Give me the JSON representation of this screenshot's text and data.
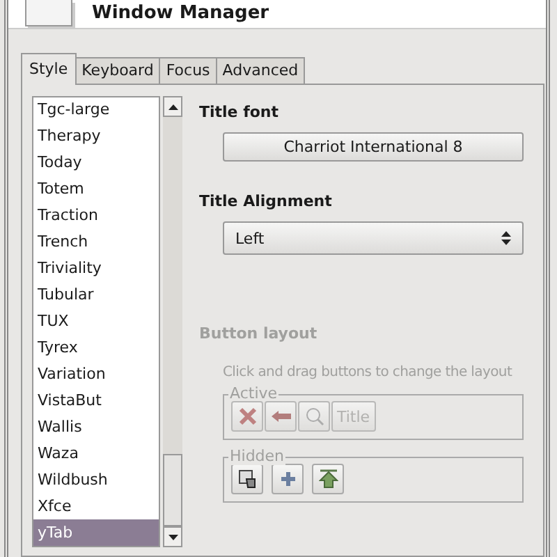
{
  "header": {
    "title": "Window Manager"
  },
  "tabs": [
    {
      "label": "Style",
      "selected": true
    },
    {
      "label": "Keyboard",
      "selected": false
    },
    {
      "label": "Focus",
      "selected": false
    },
    {
      "label": "Advanced",
      "selected": false
    }
  ],
  "themes": [
    {
      "name": "Tgc-large",
      "selected": false
    },
    {
      "name": "Therapy",
      "selected": false
    },
    {
      "name": "Today",
      "selected": false
    },
    {
      "name": "Totem",
      "selected": false
    },
    {
      "name": "Traction",
      "selected": false
    },
    {
      "name": "Trench",
      "selected": false
    },
    {
      "name": "Triviality",
      "selected": false
    },
    {
      "name": "Tubular",
      "selected": false
    },
    {
      "name": "TUX",
      "selected": false
    },
    {
      "name": "Tyrex",
      "selected": false
    },
    {
      "name": "Variation",
      "selected": false
    },
    {
      "name": "VistaBut",
      "selected": false
    },
    {
      "name": "Wallis",
      "selected": false
    },
    {
      "name": "Waza",
      "selected": false
    },
    {
      "name": "Wildbush",
      "selected": false
    },
    {
      "name": "Xfce",
      "selected": false
    },
    {
      "name": "yTab",
      "selected": true
    }
  ],
  "title_font": {
    "label": "Title font",
    "value": "Charriot International 8"
  },
  "title_alignment": {
    "label": "Title Alignment",
    "value": "Left"
  },
  "button_layout": {
    "label": "Button layout",
    "hint": "Click and drag buttons to change the layout",
    "disabled": true,
    "groups": [
      {
        "label": "Active",
        "buttons": [
          {
            "kind": "close"
          },
          {
            "kind": "arrow"
          },
          {
            "kind": "magnifier"
          },
          {
            "kind": "text",
            "label": "Title"
          }
        ]
      },
      {
        "label": "Hidden",
        "buttons": [
          {
            "kind": "hand"
          },
          {
            "kind": "plus"
          },
          {
            "kind": "up"
          }
        ]
      }
    ]
  }
}
